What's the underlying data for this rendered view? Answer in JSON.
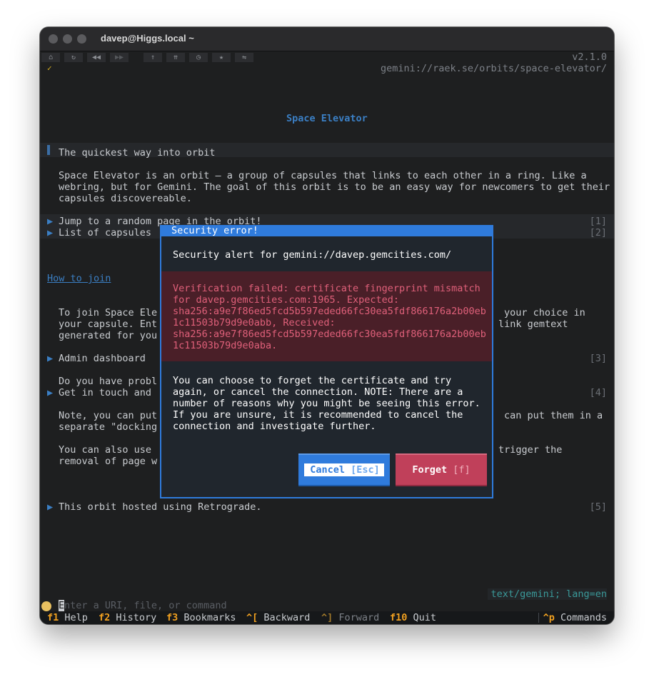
{
  "window": {
    "title": "davep@Higgs.local ~"
  },
  "toolbar": {
    "buttons": [
      {
        "icon": "home-icon",
        "glyph": "⌂"
      },
      {
        "icon": "reload-icon",
        "glyph": "↻"
      },
      {
        "icon": "back-icon",
        "glyph": "◀◀"
      },
      {
        "icon": "forward-icon",
        "glyph": "▶▶"
      },
      {
        "icon": "up-icon",
        "glyph": "↑"
      },
      {
        "icon": "root-icon",
        "glyph": "⇈"
      },
      {
        "icon": "history-icon",
        "glyph": "◷"
      },
      {
        "icon": "bookmark-icon",
        "glyph": "★"
      },
      {
        "icon": "toggle-icon",
        "glyph": "⇋"
      }
    ],
    "check": "✓",
    "version": "v2.1.0",
    "url": "gemini://raek.se/orbits/space-elevator/"
  },
  "page": {
    "heading": "Space Elevator",
    "quote": "The quickest way into orbit",
    "intro": [
      "Space Elevator is an orbit — a group of capsules that links to each other in a ring. Like a",
      "webring, but for Gemini. The goal of this orbit is to be an easy way for newcomers to get their",
      "capsules discovereable."
    ],
    "links": [
      {
        "label": "Jump to a random page in the orbit!",
        "num": "[1]"
      },
      {
        "label": "List of capsules",
        "num": "[2]"
      },
      {
        "label": "Admin dashboard",
        "num": "[3]"
      },
      {
        "label": "Get in touch and",
        "num": "[4]"
      },
      {
        "label": "This orbit hosted using Retrograde.",
        "num": "[5]"
      }
    ],
    "how_to_join": "How to join",
    "join_left": [
      "To join Space Ele",
      "your capsule. Ent",
      "generated for you"
    ],
    "join_right": [
      "your choice in",
      "link gemtext"
    ],
    "problems": "Do you have probl",
    "note_left": [
      "Note, you can put",
      "separate \"docking"
    ],
    "note_right": "can put them in a",
    "also_left": [
      "You can also use",
      "removal of page w"
    ],
    "also_right": "trigger the"
  },
  "dialog": {
    "title": "Security error!",
    "alert": "Security alert for gemini://davep.gemcities.com/",
    "error_lines": [
      "Verification failed: certificate fingerprint mismatch",
      "for davep.gemcities.com:1965. Expected:",
      "sha256:a9e7f86ed5fcd5b597eded66fc30ea5fdf866176a2b00eb",
      "1c11503b79d9e0abb, Received:",
      "sha256:a9e7f86ed5fcd5b597eded66fc30ea5fdf866176a2b00eb",
      "1c11503b79d9e0aba."
    ],
    "message_lines": [
      "You can choose to forget the certificate and try",
      "again, or cancel the connection. NOTE: There are a",
      "number of reasons why you might be seeing this error.",
      "If you are unsure, it is recommended to cancel the",
      "connection and investigate further."
    ],
    "cancel_label": "Cancel",
    "cancel_key": "[Esc]",
    "forget_label": "Forget",
    "forget_key": "[f]"
  },
  "status": {
    "mime": "text/gemini; lang=en",
    "input_placeholder": "Enter a URI, file, or command",
    "input_cursor": "E"
  },
  "footer": {
    "items": [
      {
        "key": "f1",
        "label": "Help"
      },
      {
        "key": "f2",
        "label": "History"
      },
      {
        "key": "f3",
        "label": "Bookmarks"
      },
      {
        "key": "^[",
        "label": "Backward"
      },
      {
        "key": "^]",
        "label": "Forward"
      },
      {
        "key": "f10",
        "label": "Quit"
      }
    ],
    "commands_key": "^p",
    "commands_label": "Commands"
  },
  "colors": {
    "accent": "#2f7bdc",
    "error_text": "#e0607a",
    "forget_button": "#c0405a",
    "function_key": "#f0a020"
  }
}
